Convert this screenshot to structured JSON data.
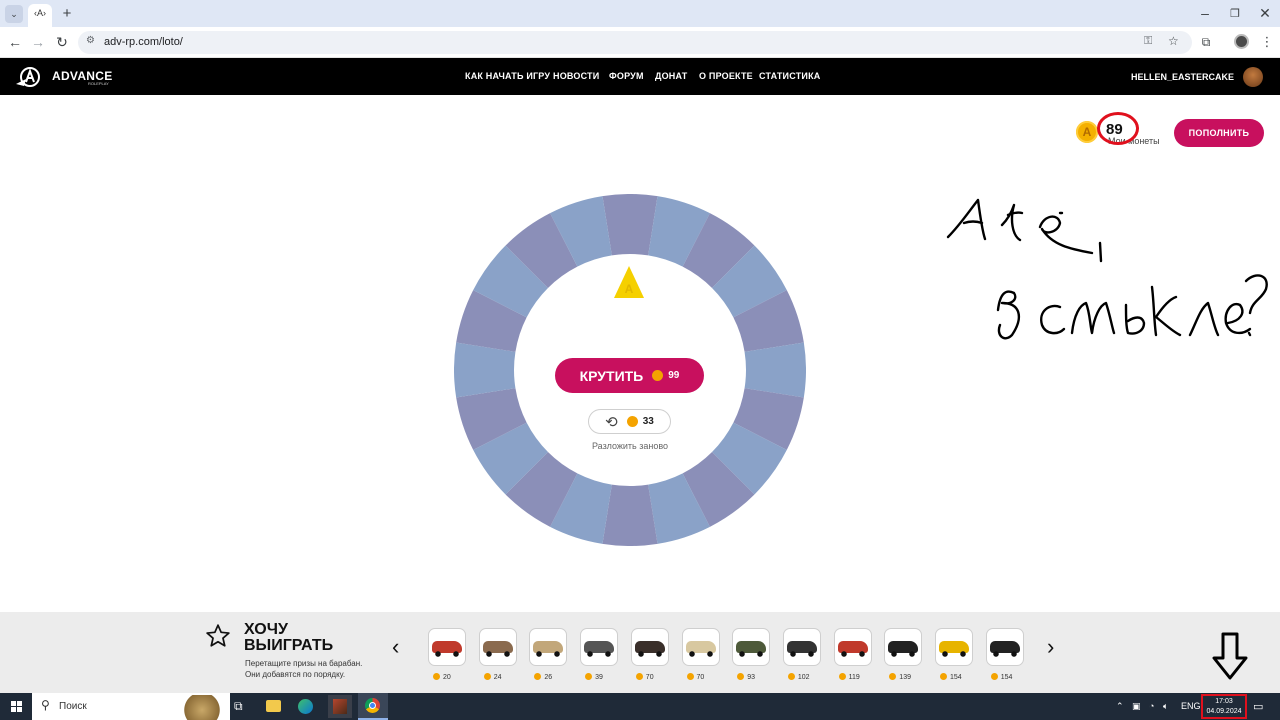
{
  "browser": {
    "url": "adv-rp.com/loto/",
    "new_tab_symbol": "+"
  },
  "site": {
    "logo_text": "ADVANCE",
    "logo_sub": "ROLEPLAY",
    "nav": [
      "КАК НАЧАТЬ ИГРУ",
      "НОВОСТИ",
      "ФОРУМ",
      "ДОНАТ",
      "О ПРОЕКТЕ",
      "СТАТИСТИКА"
    ],
    "username": "HELLEN_EASTERCAKE"
  },
  "coins": {
    "value": "89",
    "label": "Мои монеты",
    "topup_label": "ПОПОЛНИТЬ"
  },
  "wheel": {
    "spin_label": "КРУТИТЬ",
    "spin_price": "99",
    "reshuffle_price": "33",
    "reshuffle_label": "Разложить заново",
    "colors": [
      "#8b8fb8",
      "#8aa2c8"
    ]
  },
  "wishlist": {
    "title_line1": "ХОЧУ",
    "title_line2": "ВЫИГРАТЬ",
    "desc_line1": "Перетащите призы на барабан.",
    "desc_line2": "Они добавятся по порядку.",
    "prizes": [
      {
        "icon": "go-kart-icon",
        "price": "20"
      },
      {
        "icon": "van-icon",
        "price": "24"
      },
      {
        "icon": "sedan-icon",
        "price": "26"
      },
      {
        "icon": "buggy-icon",
        "price": "39"
      },
      {
        "icon": "offroad-icon",
        "price": "70"
      },
      {
        "icon": "camper-icon",
        "price": "70"
      },
      {
        "icon": "military-truck-icon",
        "price": "93"
      },
      {
        "icon": "jeep-icon",
        "price": "102"
      },
      {
        "icon": "red-coupe-icon",
        "price": "119"
      },
      {
        "icon": "sports-car-icon",
        "price": "139"
      },
      {
        "icon": "yellow-supercar-icon",
        "price": "154"
      },
      {
        "icon": "black-supercar-icon",
        "price": "154"
      }
    ]
  },
  "taskbar": {
    "search_placeholder": "Поиск",
    "lang": "ENG",
    "time": "17:03",
    "date": "04.09.2024"
  }
}
